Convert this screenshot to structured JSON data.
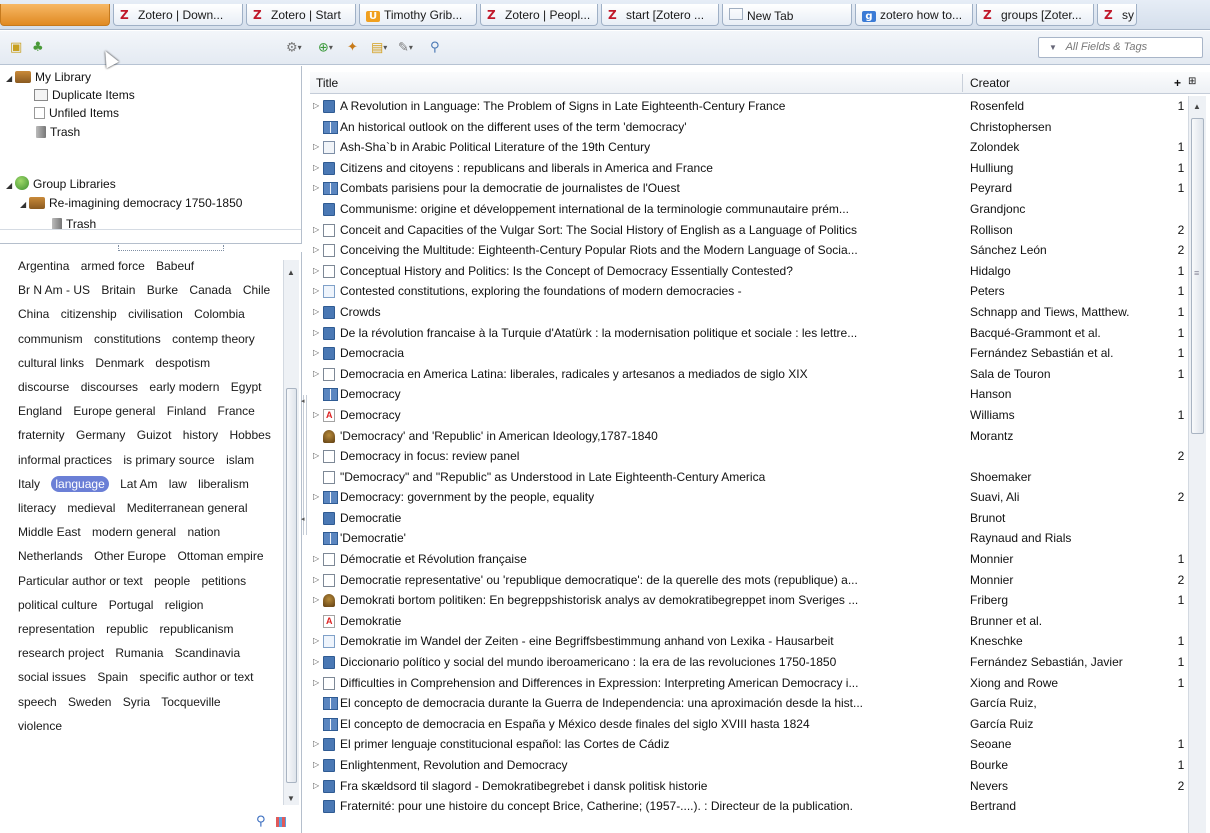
{
  "browser_tabs": [
    {
      "icon": "",
      "label": ""
    },
    {
      "icon": "Z",
      "label": "Zotero | Down..."
    },
    {
      "icon": "Z",
      "label": "Zotero | Start"
    },
    {
      "icon": "U",
      "label": "Timothy Grib..."
    },
    {
      "icon": "Z",
      "label": "Zotero | Peopl..."
    },
    {
      "icon": "Z",
      "label": "start [Zotero ..."
    },
    {
      "icon": "",
      "label": "New Tab"
    },
    {
      "icon": "g",
      "label": "zotero how to..."
    },
    {
      "icon": "Z",
      "label": "groups [Zoter..."
    },
    {
      "icon": "Z",
      "label": "sy"
    }
  ],
  "toolbar": {
    "new_collection_icon": "new-collection-icon",
    "new_group_icon": "new-group-icon",
    "actions_icon": "gear-icon",
    "new_item_icon": "plus-icon",
    "add_by_id_icon": "magic-wand-icon",
    "new_note_icon": "note-icon",
    "attachment_icon": "paperclip-icon",
    "advanced_search_icon": "magnifier-icon",
    "search_mode": "All Fields & Tags"
  },
  "collections": {
    "my_library": "My Library",
    "duplicate_items": "Duplicate Items",
    "unfiled_items": "Unfiled Items",
    "trash": "Trash",
    "group_libraries": "Group Libraries",
    "group_name": "Re-imagining democracy 1750-1850",
    "group_trash": "Trash"
  },
  "tags": [
    "Argentina",
    "armed force",
    "Babeuf",
    "Br N Am - US",
    "Britain",
    "Burke",
    "Canada",
    "Chile",
    "China",
    "citizenship",
    "civilisation",
    "Colombia",
    "communism",
    "constitutions",
    "contemp theory",
    "cultural links",
    "Denmark",
    "despotism",
    "discourse",
    "discourses",
    "early modern",
    "Egypt",
    "England",
    "Europe general",
    "Finland",
    "France",
    "fraternity",
    "Germany",
    "Guizot",
    "history",
    "Hobbes",
    "informal practices",
    "is primary source",
    "islam",
    "Italy",
    "language",
    "Lat Am",
    "law",
    "liberalism",
    "literacy",
    "medieval",
    "Mediterranean general",
    "Middle East",
    "modern general",
    "nation",
    "Netherlands",
    "Other Europe",
    "Ottoman empire",
    "Particular author or text",
    "people",
    "petitions",
    "political culture",
    "Portugal",
    "religion",
    "representation",
    "republic",
    "republicanism",
    "research project",
    "Rumania",
    "Scandinavia",
    "social issues",
    "Spain",
    "specific author or text",
    "speech",
    "Sweden",
    "Syria",
    "Tocqueville",
    "violence"
  ],
  "selected_tag": "language",
  "items_header": {
    "title": "Title",
    "creator": "Creator",
    "attachments": "+",
    "column_picker": "column-picker-icon"
  },
  "items": [
    {
      "twisty": true,
      "type": "book",
      "title": "A Revolution in Language: The Problem of Signs in Late Eighteenth-Century France",
      "creator": "Rosenfeld",
      "notes": "1"
    },
    {
      "twisty": false,
      "type": "bookopen",
      "title": "An historical outlook on the different uses of the term 'democracy'",
      "creator": "Christophersen",
      "notes": ""
    },
    {
      "twisty": true,
      "type": "chapter",
      "title": "Ash-Sha`b in Arabic Political Literature of the 19th Century",
      "creator": "Zolondek",
      "notes": "1"
    },
    {
      "twisty": true,
      "type": "book",
      "title": "Citizens and citoyens : republicans and liberals in America and France",
      "creator": "Hulliung",
      "notes": "1"
    },
    {
      "twisty": true,
      "type": "bookopen",
      "title": "Combats parisiens pour la democratie de journalistes de l'Ouest",
      "creator": "Peyrard",
      "notes": "1"
    },
    {
      "twisty": false,
      "type": "book",
      "title": "Communisme: origine et développement international de la terminologie communautaire prém...",
      "creator": "Grandjonc",
      "notes": ""
    },
    {
      "twisty": true,
      "type": "article",
      "title": "Conceit and Capacities of the Vulgar Sort: The Social History of English as a Language of Politics",
      "creator": "Rollison",
      "notes": "2"
    },
    {
      "twisty": true,
      "type": "article",
      "title": "Conceiving the Multitude: Eighteenth-Century Popular Riots and the Modern Language of Socia...",
      "creator": "Sánchez León",
      "notes": "2"
    },
    {
      "twisty": true,
      "type": "article",
      "title": "Conceptual History and Politics: Is the Concept of Democracy Essentially Contested?",
      "creator": "Hidalgo",
      "notes": "1"
    },
    {
      "twisty": true,
      "type": "doc",
      "title": "Contested constitutions, exploring the foundations of modern democracies -",
      "creator": "Peters",
      "notes": "1"
    },
    {
      "twisty": true,
      "type": "book",
      "title": "Crowds",
      "creator": "Schnapp and Tiews, Matthew.",
      "notes": "1"
    },
    {
      "twisty": true,
      "type": "book",
      "title": "De la révolution francaise à la Turquie d'Atatürk : la modernisation politique et sociale : les lettre...",
      "creator": "Bacqué-Grammont et al.",
      "notes": "1"
    },
    {
      "twisty": true,
      "type": "book",
      "title": "Democracia",
      "creator": "Fernández Sebastián et al.",
      "notes": "1"
    },
    {
      "twisty": true,
      "type": "article",
      "title": "Democracia en America Latina: liberales, radicales y artesanos a mediados de siglo XIX",
      "creator": "Sala de Touron",
      "notes": "1"
    },
    {
      "twisty": false,
      "type": "bookopen",
      "title": "Democracy",
      "creator": "Hanson",
      "notes": ""
    },
    {
      "twisty": true,
      "type": "pdf",
      "title": "Democracy",
      "creator": "Williams",
      "notes": "1"
    },
    {
      "twisty": false,
      "type": "thesis",
      "title": "'Democracy' and 'Republic' in American Ideology,1787-1840",
      "creator": "Morantz",
      "notes": ""
    },
    {
      "twisty": true,
      "type": "article",
      "title": "Democracy in focus: review panel",
      "creator": "",
      "notes": "2"
    },
    {
      "twisty": false,
      "type": "article",
      "title": "\"Democracy\" and \"Republic\" as Understood in Late Eighteenth-Century America",
      "creator": "Shoemaker",
      "notes": ""
    },
    {
      "twisty": true,
      "type": "bookopen",
      "title": "Democracy: government by the people, equality",
      "creator": "Suavi, Ali",
      "notes": "2"
    },
    {
      "twisty": false,
      "type": "book",
      "title": "Democratie",
      "creator": "Brunot",
      "notes": ""
    },
    {
      "twisty": false,
      "type": "bookopen",
      "title": "'Democratie'",
      "creator": "Raynaud and Rials",
      "notes": ""
    },
    {
      "twisty": true,
      "type": "article",
      "title": "Démocratie et Révolution française",
      "creator": "Monnier",
      "notes": "1"
    },
    {
      "twisty": true,
      "type": "article",
      "title": "Democratie representative' ou 'republique democratique': de la querelle des mots (republique) a...",
      "creator": "Monnier",
      "notes": "2"
    },
    {
      "twisty": true,
      "type": "thesis",
      "title": "Demokrati bortom politiken: En begreppshistorisk analys av demokratibegreppet inom Sveriges ...",
      "creator": "Friberg",
      "notes": "1"
    },
    {
      "twisty": false,
      "type": "pdf",
      "title": "Demokratie",
      "creator": "Brunner et al.",
      "notes": ""
    },
    {
      "twisty": true,
      "type": "doc",
      "title": "Demokratie im Wandel der Zeiten - eine Begriffsbestimmung anhand von Lexika - Hausarbeit",
      "creator": "Kneschke",
      "notes": "1"
    },
    {
      "twisty": true,
      "type": "book",
      "title": "Diccionario político y social del mundo iberoamericano : la era de las revoluciones 1750-1850",
      "creator": "Fernández Sebastián, Javier",
      "notes": "1"
    },
    {
      "twisty": true,
      "type": "article",
      "title": "Difficulties in Comprehension and Differences in Expression: Interpreting American Democracy i...",
      "creator": "Xiong and Rowe",
      "notes": "1"
    },
    {
      "twisty": false,
      "type": "bookopen",
      "title": "El concepto de democracia durante la Guerra de Independencia: una aproximación desde la hist...",
      "creator": "García Ruiz,",
      "notes": ""
    },
    {
      "twisty": false,
      "type": "bookopen",
      "title": "El concepto de democracia en España y México desde finales del siglo XVIII hasta 1824",
      "creator": "García Ruiz",
      "notes": ""
    },
    {
      "twisty": true,
      "type": "book",
      "title": "El primer lenguaje constitucional español: las Cortes de Cádiz",
      "creator": "Seoane",
      "notes": "1"
    },
    {
      "twisty": true,
      "type": "book",
      "title": "Enlightenment, Revolution and Democracy",
      "creator": "Bourke",
      "notes": "1"
    },
    {
      "twisty": true,
      "type": "book",
      "title": "Fra skældsord til slagord - Demokratibegrebet i dansk politisk historie",
      "creator": "Nevers",
      "notes": "2"
    },
    {
      "twisty": false,
      "type": "book",
      "title": "Fraternité: pour une histoire du concept Brice, Catherine; (1957-....). : Directeur de la publication.",
      "creator": "Bertrand",
      "notes": ""
    }
  ]
}
